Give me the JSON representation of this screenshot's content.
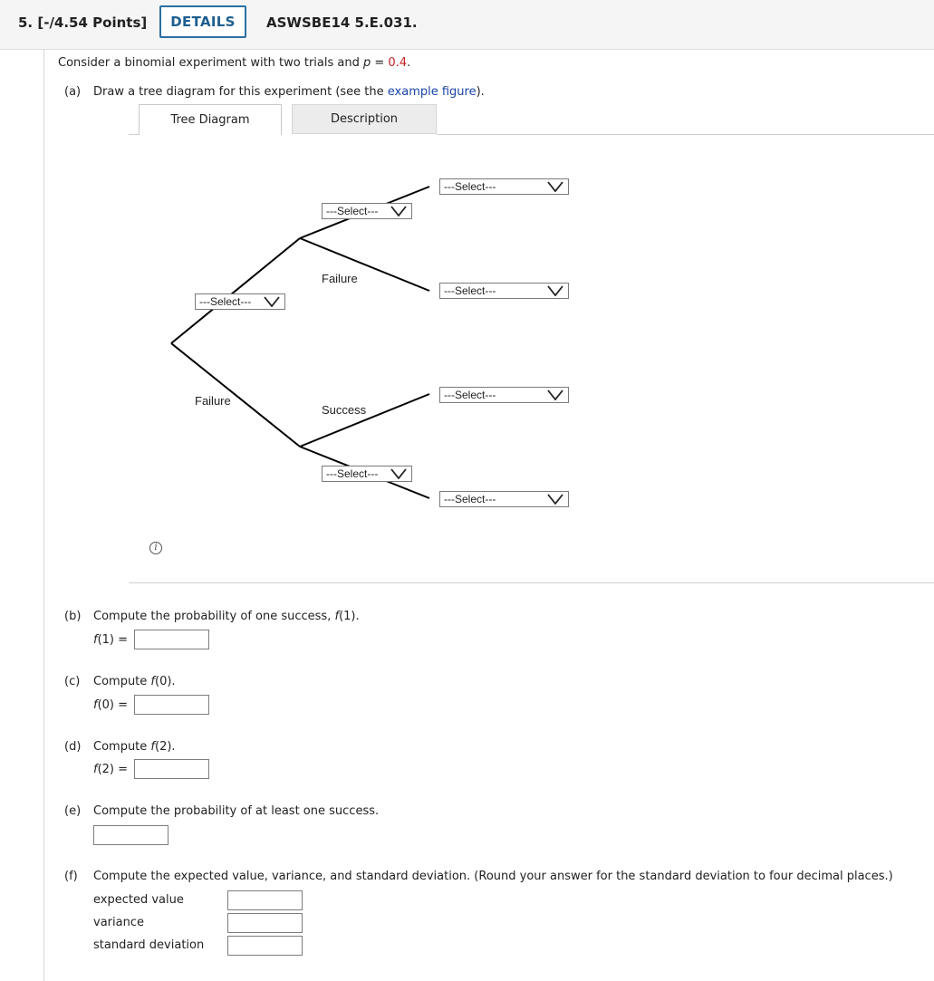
{
  "header": {
    "points": "5.  [-/4.54 Points]",
    "details": "DETAILS",
    "question_id": "ASWSBE14 5.E.031."
  },
  "intro": {
    "prefix": "Consider a binomial experiment with two trials and ",
    "var": "p",
    "eq": " = ",
    "value": "0.4",
    "suffix": "."
  },
  "part_a": {
    "label": "(a)",
    "text_before": "Draw a tree diagram for this experiment (see the ",
    "link": "example figure",
    "text_after": ")."
  },
  "tabs": {
    "tree": "Tree Diagram",
    "description": "Description"
  },
  "tree": {
    "selects": {
      "first_upper": "---Select---",
      "upper_upper": "---Select---",
      "lower_lower": "---Select---",
      "outcome_1": "---Select---",
      "outcome_2": "---Select---",
      "outcome_3": "---Select---",
      "outcome_4": "---Select---"
    },
    "labels": {
      "first_lower": "Failure",
      "upper_lower": "Failure",
      "lower_upper": "Success"
    }
  },
  "part_b": {
    "label": "(b)",
    "text": "Compute the probability of one success, ",
    "fn": "f",
    "arg": "(1).",
    "answer_label_fn": "f",
    "answer_label_arg": "(1)",
    "eq": " = ",
    "value": ""
  },
  "part_c": {
    "label": "(c)",
    "text": "Compute ",
    "fn": "f",
    "arg": "(0).",
    "answer_label_fn": "f",
    "answer_label_arg": "(0)",
    "eq": " = ",
    "value": ""
  },
  "part_d": {
    "label": "(d)",
    "text": "Compute ",
    "fn": "f",
    "arg": "(2).",
    "answer_label_fn": "f",
    "answer_label_arg": "(2)",
    "eq": " = ",
    "value": ""
  },
  "part_e": {
    "label": "(e)",
    "text": "Compute the probability of at least one success.",
    "value": ""
  },
  "part_f": {
    "label": "(f)",
    "text": "Compute the expected value, variance, and standard deviation. (Round your answer for the standard deviation to four decimal places.)",
    "expected_label": "expected value",
    "variance_label": "variance",
    "sd_label": "standard deviation",
    "expected_value": "",
    "variance_value": "",
    "sd_value": ""
  }
}
